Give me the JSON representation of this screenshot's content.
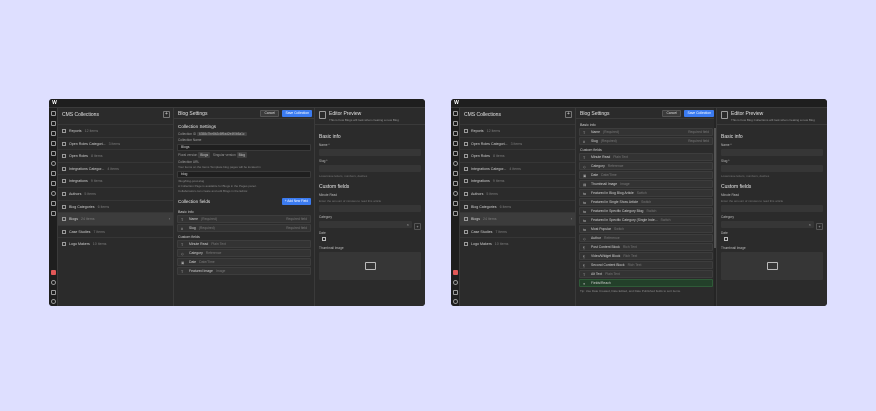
{
  "left": {
    "app_logo": "W",
    "collections_title": "CMS Collections",
    "collections": [
      {
        "label": "Reports",
        "count": "12 items"
      },
      {
        "label": "Open Roles Categori...",
        "count": "3 items"
      },
      {
        "label": "Open Roles",
        "count": "8 items"
      },
      {
        "label": "Integrations Categor...",
        "count": "4 items"
      },
      {
        "label": "Integrations",
        "count": "9 items"
      },
      {
        "label": "Authors",
        "count": "5 items"
      },
      {
        "label": "Blog Categories",
        "count": "6 items"
      },
      {
        "label": "Blogs",
        "count": "24 items"
      },
      {
        "label": "Case Studies",
        "count": "7 items"
      },
      {
        "label": "Logo Makers",
        "count": "10 items"
      }
    ],
    "settings_title": "Blog Settings",
    "cancel_label": "Cancel",
    "save_label": "Save Collection",
    "collection_settings_title": "Collection Settings",
    "collection_id_label": "Collection ID",
    "collection_id_value": "6358c7be8b2c8f9ad2e4f0b5a1c",
    "collection_name_label": "Collection Name",
    "collection_name_value": "Blogs",
    "plural_label": "Plural version",
    "plural_value": "Blogs",
    "singular_label": "Singular version",
    "singular_value": "Blog",
    "url_label": "Collection URL",
    "url_value": "blog",
    "url_hint": "Your items on the Items Template blog pages will be located in",
    "url_preview": "/blog/blog-post-slug",
    "notice_1": "A Collection Page is available for Blogs in the Pages panel.",
    "notice_2": "Collaborators can create and edit Blogs in the Editor.",
    "collection_fields_title": "Collection fields",
    "new_field_label": "+ Add New Field",
    "basic_info_title": "Basic info",
    "basic_fields": [
      {
        "icon": "T",
        "label": "Name",
        "help": "(Required)",
        "req": "Required field"
      },
      {
        "icon": "#",
        "label": "Slug",
        "help": "(Required)",
        "req": "Required field"
      }
    ],
    "custom_fields_title": "Custom fields",
    "custom_fields": [
      {
        "icon": "T",
        "label": "Minute Read",
        "help": "Plain Text"
      },
      {
        "icon": "◇",
        "label": "Category",
        "help": "Reference"
      },
      {
        "icon": "▣",
        "label": "Date",
        "help": "Date/Time"
      },
      {
        "icon": "T",
        "label": "Featured Image",
        "help": "Image"
      }
    ],
    "preview_title": "Editor Preview",
    "preview_subtitle": "This is how Blogs will look when creating a new Blog",
    "pv_basic_info": "Basic info",
    "pv_name_label": "Name *",
    "pv_slug_label": "Slug *",
    "pv_slug_hint": "Lowercase letters, numbers, dashes",
    "pv_custom_fields": "Custom fields",
    "pv_minute_label": "Minute Read",
    "pv_minute_hint": "Enter the amount of minutes to read this article",
    "pv_category_label": "Category",
    "pv_category_placeholder": "Select...",
    "pv_date_label": "Date",
    "pv_image_label": "Thumbnail Image"
  },
  "right": {
    "app_logo": "W",
    "collections_title": "CMS Collections",
    "collections": [
      {
        "label": "Reports",
        "count": "12 items"
      },
      {
        "label": "Open Roles Categori...",
        "count": "3 items"
      },
      {
        "label": "Open Roles",
        "count": "8 items"
      },
      {
        "label": "Integrations Categor...",
        "count": "4 items"
      },
      {
        "label": "Integrations",
        "count": "9 items"
      },
      {
        "label": "Authors",
        "count": "5 items"
      },
      {
        "label": "Blog Categories",
        "count": "6 items"
      },
      {
        "label": "Blogs",
        "count": "24 items"
      },
      {
        "label": "Case Studies",
        "count": "7 items"
      },
      {
        "label": "Logo Makers",
        "count": "10 items"
      }
    ],
    "settings_title": "Blog Settings",
    "cancel_label": "Cancel",
    "save_label": "Save Collection",
    "basic_info_title": "Basic info",
    "basic_fields": [
      {
        "icon": "T",
        "label": "Name",
        "help": "(Required)",
        "req": "Required field"
      },
      {
        "icon": "#",
        "label": "Slug",
        "help": "(Required)",
        "req": "Required field"
      }
    ],
    "custom_fields_title": "Custom fields",
    "custom_fields": [
      {
        "icon": "T",
        "label": "Minute Read",
        "help": "Plain Text"
      },
      {
        "icon": "◇",
        "label": "Category",
        "help": "Reference"
      },
      {
        "icon": "▣",
        "label": "Date",
        "help": "Date/Time"
      },
      {
        "icon": "▤",
        "label": "Thumbnail Image",
        "help": "Image"
      },
      {
        "icon": "⇆",
        "label": "Featured in Blog Blog Article",
        "help": "Switch"
      },
      {
        "icon": "⇆",
        "label": "Featured in Single Show Article",
        "help": "Switch"
      },
      {
        "icon": "⇆",
        "label": "Featured in Specific Category Blog",
        "help": "Switch"
      },
      {
        "icon": "⇆",
        "label": "Featured in Specific Category (Single Inde...",
        "help": "Switch"
      },
      {
        "icon": "⇆",
        "label": "Most Popular",
        "help": "Switch"
      },
      {
        "icon": "◇",
        "label": "Author",
        "help": "Reference"
      },
      {
        "icon": "¶",
        "label": "Post Content Block",
        "help": "Rich Text"
      },
      {
        "icon": "¶",
        "label": "Video/Widget Block",
        "help": "Rich Text"
      },
      {
        "icon": "¶",
        "label": "Second Content Block",
        "help": "Rich Text"
      },
      {
        "icon": "T",
        "label": "Alt Text",
        "help": "Plain Text"
      }
    ],
    "highlight_row": {
      "icon": "●",
      "label": "Fields/Reach"
    },
    "footnote": "Tip: Use Date Created, Date Edited, and Date Published fields to sort items.",
    "preview_title": "Editor Preview",
    "preview_subtitle": "This is how Blog Collections will look when creating a new Blog",
    "pv_basic_info": "Basic info",
    "pv_name_label": "Name *",
    "pv_slug_label": "Slug *",
    "pv_slug_hint": "Lowercase letters, numbers, dashes",
    "pv_custom_fields": "Custom fields",
    "pv_minute_label": "Minute Read",
    "pv_minute_hint": "Enter the amount of minutes to read this article",
    "pv_category_label": "Category",
    "pv_category_placeholder": "Select...",
    "pv_date_label": "Date",
    "pv_image_label": "Thumbnail Image"
  },
  "colors": {
    "page_background": "#dedfff",
    "panel": "#2b2b2b",
    "accent": "#3b7bf0",
    "highlight_green": "#23402a"
  }
}
